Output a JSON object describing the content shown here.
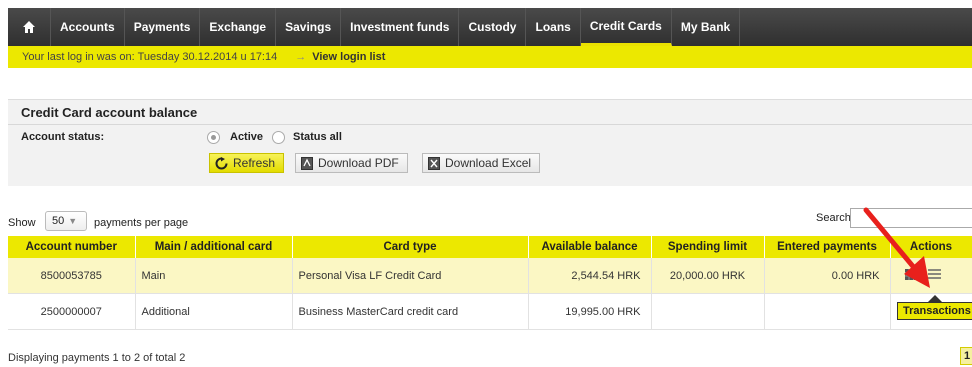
{
  "nav": {
    "home_icon": "home-icon",
    "items": [
      {
        "label": "Accounts"
      },
      {
        "label": "Payments"
      },
      {
        "label": "Exchange"
      },
      {
        "label": "Savings"
      },
      {
        "label": "Investment funds"
      },
      {
        "label": "Custody"
      },
      {
        "label": "Loans"
      },
      {
        "label": "Credit Cards"
      },
      {
        "label": "My Bank"
      }
    ]
  },
  "login": {
    "text": "Your last log in was on: Tuesday 30.12.2014 u 17:14",
    "arrow": "→",
    "link": "View login list"
  },
  "panel": {
    "title": "Credit Card account balance",
    "status_label": "Account status:",
    "options": [
      "Active",
      "Status all"
    ],
    "selected": "Active",
    "buttons": {
      "refresh": "Refresh",
      "pdf": "Download PDF",
      "excel": "Download Excel"
    }
  },
  "table_controls": {
    "show": "Show",
    "page_size": "50",
    "per_page": "payments per page",
    "search": "Search:"
  },
  "table": {
    "columns": [
      "Account number",
      "Main / additional card",
      "Card type",
      "Available balance",
      "Spending limit",
      "Entered payments",
      "Actions"
    ],
    "rows": [
      {
        "account": "8500053785",
        "card": "Main",
        "type": "Personal Visa LF Credit Card",
        "balance": "2,544.54 HRK",
        "limit": "20,000.00 HRK",
        "entered": "0.00 HRK"
      },
      {
        "account": "2500000007",
        "card": "Additional",
        "type": "Business MasterCard credit card",
        "balance": "19,995.00 HRK",
        "limit": "",
        "entered": ""
      }
    ]
  },
  "footer": {
    "text": "Displaying payments 1 to 2 of total 2",
    "page": "1"
  },
  "tooltip": "Transactions",
  "colors": {
    "accent_yellow": "#ece800",
    "nav_dark": "#3a3a3a",
    "highlight_row": "#fbf7c4",
    "arrow_red": "#e8201c"
  }
}
